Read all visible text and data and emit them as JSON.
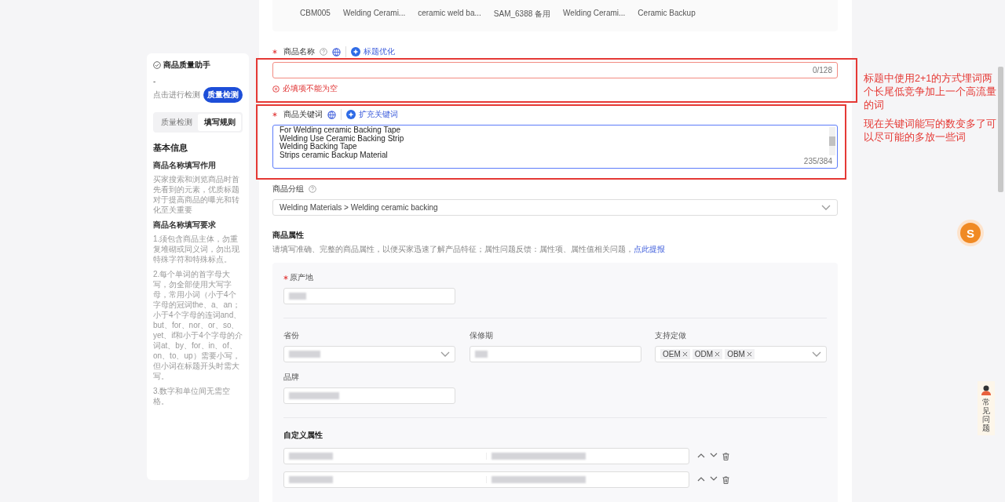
{
  "sidebar": {
    "title": "商品质量助手",
    "score": "-",
    "hint": "点击进行检测",
    "check_button": "质量检测",
    "tabs": [
      {
        "label": "质量检测",
        "selected": false
      },
      {
        "label": "填写规则",
        "selected": true
      }
    ],
    "section": "基本信息",
    "blocks": [
      {
        "heading": "商品名称填写作用",
        "paragraphs": [
          "买家搜索和浏览商品时首先看到的元素，优质标题对于提高商品的曝光和转化至关重要"
        ]
      },
      {
        "heading": "商品名称填写要求",
        "paragraphs": [
          "1.须包含商品主体，勿重复堆砌或同义词，勿出现特殊字符和特殊标点。",
          "2.每个单词的首字母大写，勿全部使用大写字母，常用小词（小于4个字母的冠词the、a、an；小于4个字母的连词and、but、for、nor、or、so、yet、if和小于4个字母的介词at、by、for、in、of、on、to、up）需要小写，但小词在标题开头时需大写。",
          "3.数字和单位间无需空格。"
        ]
      }
    ]
  },
  "sku_row": [
    "CBM005",
    "Welding Cerami...",
    "ceramic weld ba...",
    "SAM_6388 备用",
    "Welding Cerami...",
    "Ceramic Backup"
  ],
  "title_field": {
    "label": "商品名称",
    "required": true,
    "action": "标题优化",
    "counter": "0/128",
    "error": "必填项不能为空"
  },
  "keywords_field": {
    "label": "商品关键词",
    "required": true,
    "action": "扩充关键词",
    "lines": [
      "For Welding ceramic Backing Tape",
      "Welding Use Ceramic Backing Strip",
      "Welding Backing Tape",
      "Strips ceramic Backup Material"
    ],
    "counter": "235/384"
  },
  "group_field": {
    "label": "商品分组",
    "value": "Welding Materials > Welding ceramic backing"
  },
  "attributes": {
    "heading": "商品属性",
    "description": "请填写准确、完整的商品属性，以便买家迅速了解产品特征；属性问题反馈：属性项、属性值相关问题，",
    "link": "点此提报",
    "origin": {
      "label": "原产地",
      "required": true
    },
    "row": [
      {
        "label": "省份",
        "kind": "select"
      },
      {
        "label": "保修期",
        "kind": "input"
      },
      {
        "label": "支持定做",
        "kind": "tags",
        "tags": [
          "OEM",
          "ODM",
          "OBM"
        ]
      }
    ],
    "brand": {
      "label": "品牌"
    },
    "custom_heading": "自定义属性"
  },
  "annotations": [
    "标题中使用2+1的方式埋词两个长尾低竞争加上一个高流量的词",
    "现在关键词能写的数变多了可以尽可能的多放一些词"
  ],
  "float_badge": "S",
  "faq": "常见问题"
}
